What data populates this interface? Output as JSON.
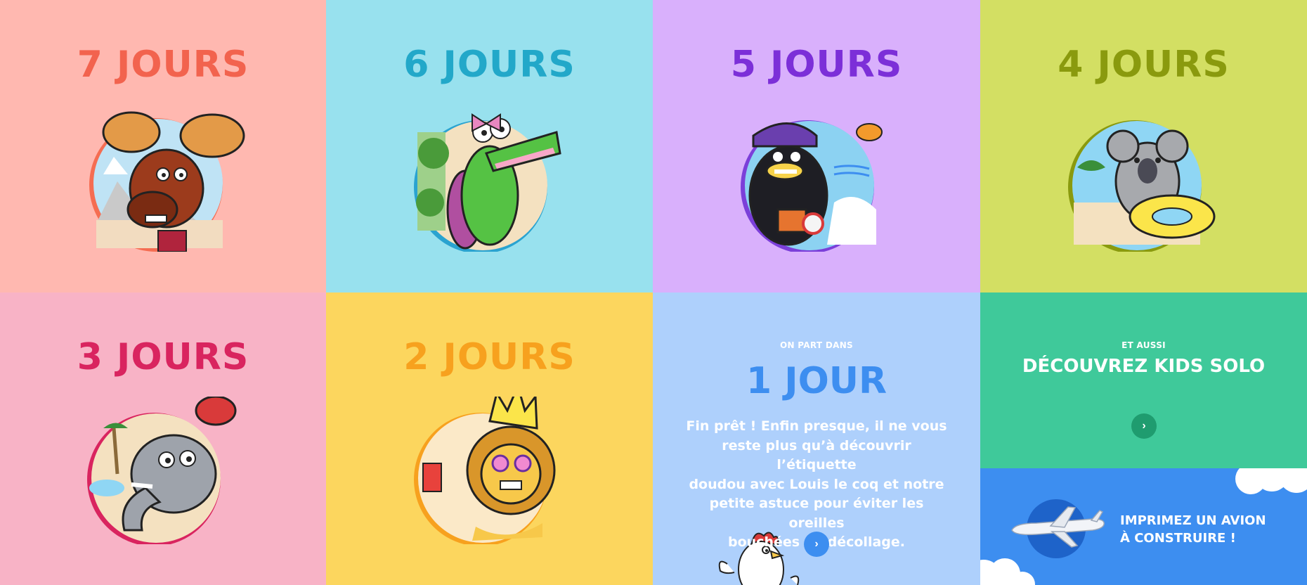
{
  "tiles": {
    "day7": {
      "title": "7 JOURS",
      "color": "#f2634e",
      "bg": "#ffb8b0"
    },
    "day6": {
      "title": "6 JOURS",
      "color": "#22a8c9",
      "bg": "#98e1ee"
    },
    "day5": {
      "title": "5 JOURS",
      "color": "#7c2fd8",
      "bg": "#d9b0fc"
    },
    "day4": {
      "title": "4 JOURS",
      "color": "#8a9a0e",
      "bg": "#d3df63"
    },
    "day3": {
      "title": "3 JOURS",
      "color": "#d9245f",
      "bg": "#f8b3c6"
    },
    "day2": {
      "title": "2 JOURS",
      "color": "#f7a11e",
      "bg": "#fcd65e"
    },
    "day1": {
      "kicker": "ON PART DANS",
      "title": "1 JOUR",
      "color": "#3d8ef0",
      "bg": "#aed0fc",
      "text_lines": [
        "Fin prêt ! Enfin presque, il ne vous",
        "reste plus qu’à découvrir l’étiquette",
        "doudou avec Louis le coq et notre",
        "petite astuce pour éviter les oreilles",
        "bouchées au décollage."
      ],
      "button_icon": "chevron-right-icon"
    },
    "kids_solo": {
      "kicker": "ET AUSSI",
      "title": "DÉCOUVREZ KIDS SOLO",
      "bg": "#3fc99a",
      "button_color": "#1f9c6f",
      "button_icon": "chevron-right-icon"
    },
    "plane": {
      "line1": "IMPRIMEZ UN AVION",
      "line2": "À CONSTRUIRE !",
      "bg": "#3d8ef0",
      "icon": "airplane-icon"
    }
  }
}
